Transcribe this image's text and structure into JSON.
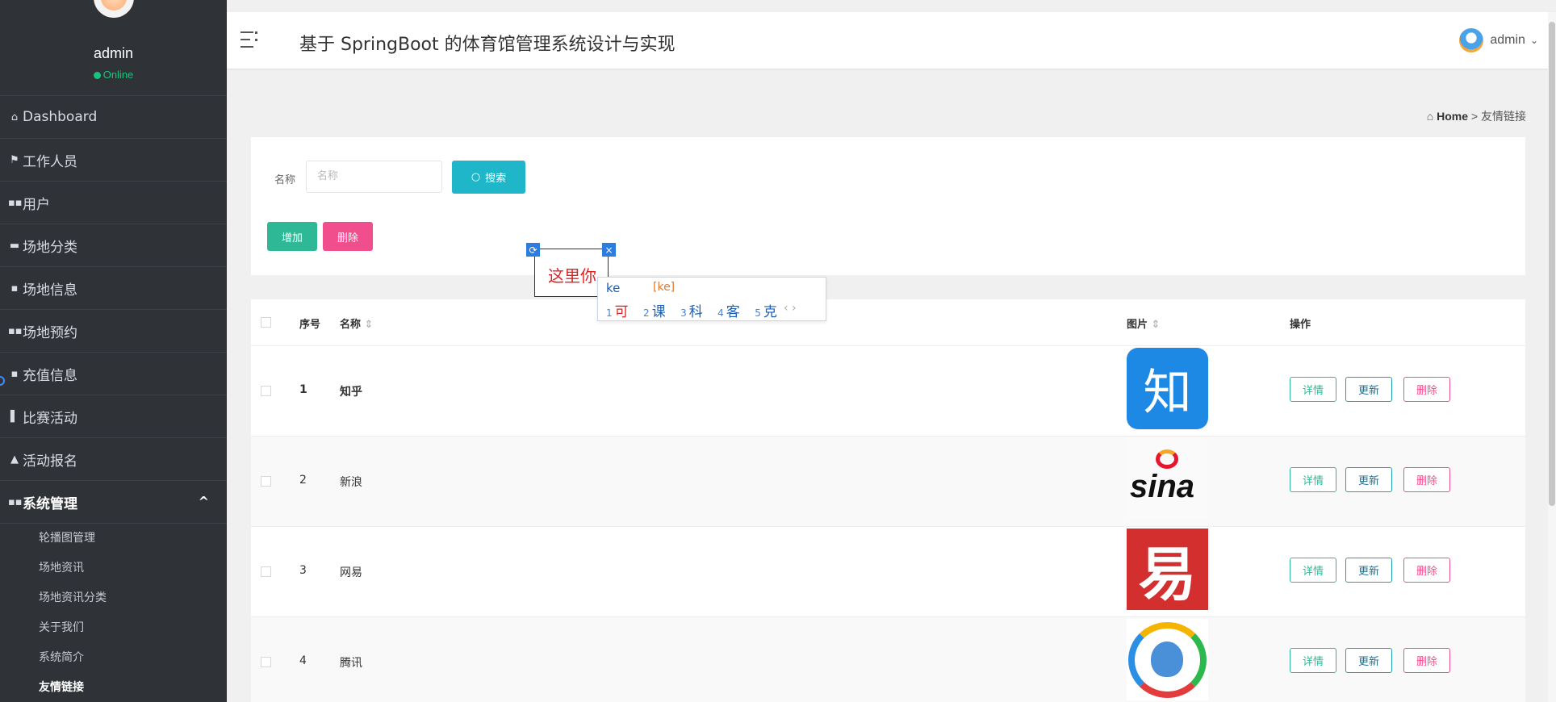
{
  "sidebar": {
    "user": {
      "name": "admin",
      "status": "Online"
    },
    "items": [
      {
        "icon": "home-icon",
        "glyph": "⌂",
        "label": "Dashboard"
      },
      {
        "icon": "flag-icon",
        "glyph": "⚑",
        "label": "工作人员"
      },
      {
        "icon": "grid-icon",
        "glyph": "▪▪",
        "label": "用户"
      },
      {
        "icon": "category-icon",
        "glyph": "▬",
        "label": "场地分类"
      },
      {
        "icon": "doc-icon",
        "glyph": "▪",
        "label": "场地信息"
      },
      {
        "icon": "grid-icon",
        "glyph": "▪▪",
        "label": "场地预约"
      },
      {
        "icon": "doc-icon",
        "glyph": "▪",
        "label": "充值信息"
      },
      {
        "icon": "bar-chart-icon",
        "glyph": "▌",
        "label": "比赛活动"
      },
      {
        "icon": "signup-icon",
        "glyph": "▲",
        "label": "活动报名"
      }
    ],
    "system": {
      "icon": "grid-icon",
      "glyph": "▪▪",
      "label": "系统管理",
      "caret": "^",
      "children": [
        "轮播图管理",
        "场地资讯",
        "场地资讯分类",
        "关于我们",
        "系统简介",
        "友情链接"
      ],
      "active_child": "友情链接"
    }
  },
  "header": {
    "title": "基于 SpringBoot 的体育馆管理系统设计与实现",
    "user": "admin"
  },
  "breadcrumb": {
    "home": "Home",
    "sep": ">",
    "current": "友情链接"
  },
  "search": {
    "label": "名称",
    "placeholder": "名称",
    "button": "搜索",
    "add_button": "增加",
    "delete_button": "删除"
  },
  "table": {
    "columns": {
      "index": "序号",
      "name": "名称",
      "image": "图片",
      "actions": "操作"
    },
    "rows": [
      {
        "index": "1",
        "name": "知乎",
        "logo": "zhihu"
      },
      {
        "index": "2",
        "name": "新浪",
        "logo": "sina"
      },
      {
        "index": "3",
        "name": "网易",
        "logo": "netease"
      },
      {
        "index": "4",
        "name": "腾讯",
        "logo": "tencent"
      }
    ],
    "actions": {
      "detail": "详情",
      "update": "更新",
      "delete": "删除"
    }
  },
  "logo_text": {
    "zhihu": "知",
    "sina": "sina",
    "netease": "易"
  },
  "ime": {
    "typed": "这里你",
    "composition": "ke",
    "pinyin": "[ke]",
    "candidates": [
      {
        "n": "1",
        "c": "可"
      },
      {
        "n": "2",
        "c": "课"
      },
      {
        "n": "3",
        "c": "科"
      },
      {
        "n": "4",
        "c": "客"
      },
      {
        "n": "5",
        "c": "克"
      }
    ],
    "pager": "‹ ›"
  },
  "colors": {
    "sidebar_bg": "#2f3338",
    "online": "#19c37d",
    "search_btn": "#1fb6c9",
    "add_btn": "#2fb896",
    "delete_btn": "#f04e8d",
    "ime_accent": "#2b7de1"
  }
}
